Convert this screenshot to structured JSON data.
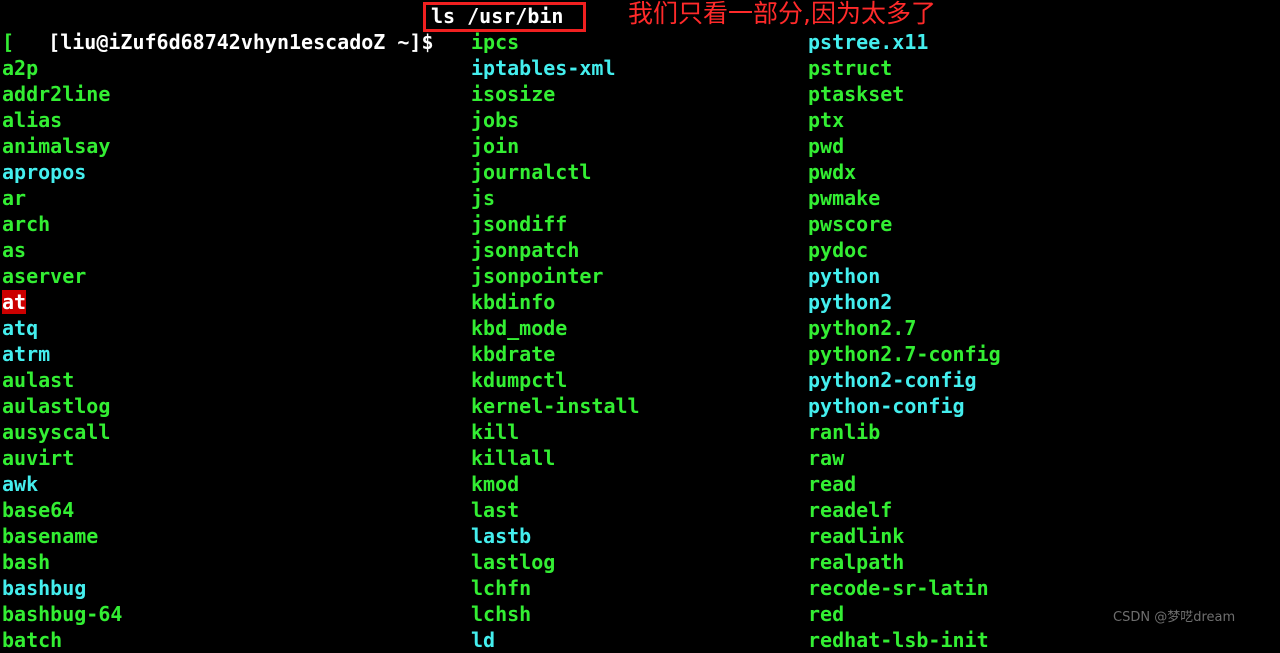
{
  "terminal": {
    "background_color": "#000000",
    "prompt": "[liu@iZuf6d68742vhyn1escadoZ ~]$",
    "prompt_color": "#ffffff",
    "command": "ls /usr/bin",
    "command_box_color": "#f02020",
    "annotation": "我们只看一部分,因为太多了",
    "annotation_color": "#ff2a2a",
    "colors": {
      "executable": "#33ee33",
      "symlink": "#44eeee",
      "setuid_bg": "#cc0000",
      "setuid_fg": "#ffffff"
    }
  },
  "watermark": "CSDN @梦呓dream",
  "listing": {
    "columns": [
      {
        "name": "column-1",
        "entries": [
          {
            "label": "[",
            "type": "executable"
          },
          {
            "label": "a2p",
            "type": "executable"
          },
          {
            "label": "addr2line",
            "type": "executable"
          },
          {
            "label": "alias",
            "type": "executable"
          },
          {
            "label": "animalsay",
            "type": "executable"
          },
          {
            "label": "apropos",
            "type": "symlink"
          },
          {
            "label": "ar",
            "type": "executable"
          },
          {
            "label": "arch",
            "type": "executable"
          },
          {
            "label": "as",
            "type": "executable"
          },
          {
            "label": "aserver",
            "type": "executable"
          },
          {
            "label": "at",
            "type": "setuid"
          },
          {
            "label": "atq",
            "type": "symlink"
          },
          {
            "label": "atrm",
            "type": "symlink"
          },
          {
            "label": "aulast",
            "type": "executable"
          },
          {
            "label": "aulastlog",
            "type": "executable"
          },
          {
            "label": "ausyscall",
            "type": "executable"
          },
          {
            "label": "auvirt",
            "type": "executable"
          },
          {
            "label": "awk",
            "type": "symlink"
          },
          {
            "label": "base64",
            "type": "executable"
          },
          {
            "label": "basename",
            "type": "executable"
          },
          {
            "label": "bash",
            "type": "executable"
          },
          {
            "label": "bashbug",
            "type": "symlink"
          },
          {
            "label": "bashbug-64",
            "type": "executable"
          },
          {
            "label": "batch",
            "type": "executable"
          }
        ]
      },
      {
        "name": "column-2",
        "entries": [
          {
            "label": "ipcs",
            "type": "executable"
          },
          {
            "label": "iptables-xml",
            "type": "symlink"
          },
          {
            "label": "isosize",
            "type": "executable"
          },
          {
            "label": "jobs",
            "type": "executable"
          },
          {
            "label": "join",
            "type": "executable"
          },
          {
            "label": "journalctl",
            "type": "executable"
          },
          {
            "label": "js",
            "type": "executable"
          },
          {
            "label": "jsondiff",
            "type": "executable"
          },
          {
            "label": "jsonpatch",
            "type": "executable"
          },
          {
            "label": "jsonpointer",
            "type": "executable"
          },
          {
            "label": "kbdinfo",
            "type": "executable"
          },
          {
            "label": "kbd_mode",
            "type": "executable"
          },
          {
            "label": "kbdrate",
            "type": "executable"
          },
          {
            "label": "kdumpctl",
            "type": "executable"
          },
          {
            "label": "kernel-install",
            "type": "executable"
          },
          {
            "label": "kill",
            "type": "executable"
          },
          {
            "label": "killall",
            "type": "executable"
          },
          {
            "label": "kmod",
            "type": "executable"
          },
          {
            "label": "last",
            "type": "executable"
          },
          {
            "label": "lastb",
            "type": "symlink"
          },
          {
            "label": "lastlog",
            "type": "executable"
          },
          {
            "label": "lchfn",
            "type": "executable"
          },
          {
            "label": "lchsh",
            "type": "executable"
          },
          {
            "label": "ld",
            "type": "symlink"
          }
        ]
      },
      {
        "name": "column-3",
        "entries": [
          {
            "label": "pstree.x11",
            "type": "symlink"
          },
          {
            "label": "pstruct",
            "type": "executable"
          },
          {
            "label": "ptaskset",
            "type": "executable"
          },
          {
            "label": "ptx",
            "type": "executable"
          },
          {
            "label": "pwd",
            "type": "executable"
          },
          {
            "label": "pwdx",
            "type": "executable"
          },
          {
            "label": "pwmake",
            "type": "executable"
          },
          {
            "label": "pwscore",
            "type": "executable"
          },
          {
            "label": "pydoc",
            "type": "executable"
          },
          {
            "label": "python",
            "type": "symlink"
          },
          {
            "label": "python2",
            "type": "symlink"
          },
          {
            "label": "python2.7",
            "type": "executable"
          },
          {
            "label": "python2.7-config",
            "type": "executable"
          },
          {
            "label": "python2-config",
            "type": "symlink"
          },
          {
            "label": "python-config",
            "type": "symlink"
          },
          {
            "label": "ranlib",
            "type": "executable"
          },
          {
            "label": "raw",
            "type": "executable"
          },
          {
            "label": "read",
            "type": "executable"
          },
          {
            "label": "readelf",
            "type": "executable"
          },
          {
            "label": "readlink",
            "type": "executable"
          },
          {
            "label": "realpath",
            "type": "executable"
          },
          {
            "label": "recode-sr-latin",
            "type": "executable"
          },
          {
            "label": "red",
            "type": "executable"
          },
          {
            "label": "redhat-lsb-init",
            "type": "executable"
          }
        ]
      }
    ]
  }
}
